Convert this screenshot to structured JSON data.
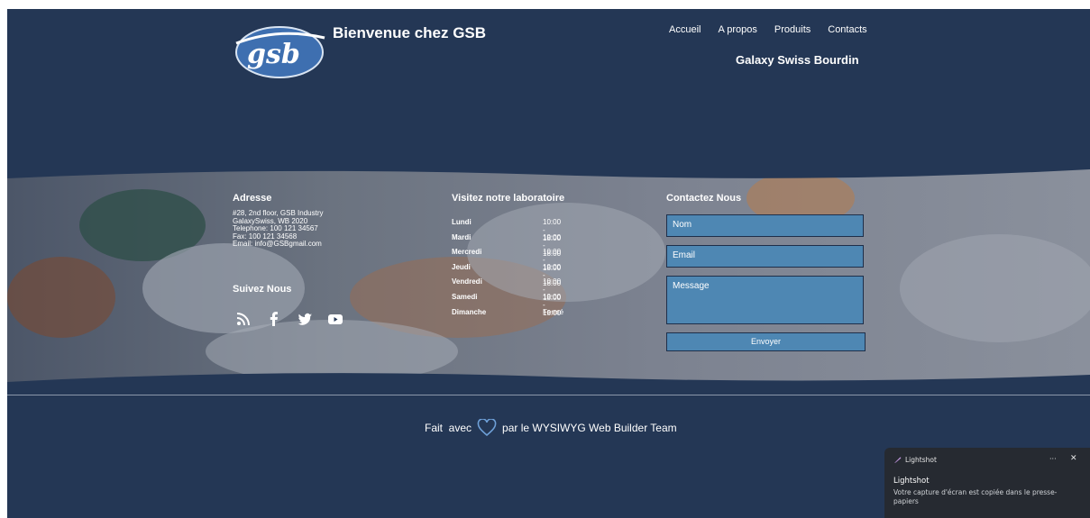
{
  "header": {
    "site_title": "Bienvenue chez GSB",
    "company_name": "Galaxy Swiss Bourdin",
    "logo_text": "gsb",
    "nav": [
      "Accueil",
      "A propos",
      "Produits",
      "Contacts"
    ]
  },
  "address": {
    "title": "Adresse",
    "lines": [
      "#28, 2nd floor, GSB Industry",
      "GalaxySwiss, WB 2020",
      "Telephone: 100 121 34567",
      "Fax: 100 121 34568",
      "Email: info@GSBgmail.com"
    ]
  },
  "social": {
    "title": "Suivez Nous",
    "icons": [
      "rss-icon",
      "facebook-icon",
      "twitter-icon",
      "youtube-icon"
    ]
  },
  "lab": {
    "title": "Visitez notre laboratoire",
    "hours": [
      {
        "day": "Lundi",
        "time": "10:00 - 18:00"
      },
      {
        "day": "Mardi",
        "time": "10:00 - 18:00"
      },
      {
        "day": "Mercredi",
        "time": "10:00 - 18:00"
      },
      {
        "day": "Jeudi",
        "time": "10:00 - 18:00"
      },
      {
        "day": "Vendredi",
        "time": "10:00 - 18:00"
      },
      {
        "day": "Samedi",
        "time": "10:00 - 18:00"
      },
      {
        "day": "Dimanche",
        "time": "Fermé"
      }
    ]
  },
  "contact": {
    "title": "Contactez Nous",
    "name_placeholder": "Nom",
    "email_placeholder": "Email",
    "message_placeholder": "Message",
    "submit_label": "Envoyer"
  },
  "footer": {
    "prefix": "Fait  avec",
    "suffix": "par le WYSIWYG Web Builder Team"
  },
  "notification": {
    "app": "Lightshot",
    "more": "···",
    "close": "✕",
    "title": "Lightshot",
    "message": "Votre capture d'écran est copiée dans le presse-papiers"
  },
  "colors": {
    "background": "#243755",
    "field": "#4e87b3",
    "toast": "#262a31"
  }
}
